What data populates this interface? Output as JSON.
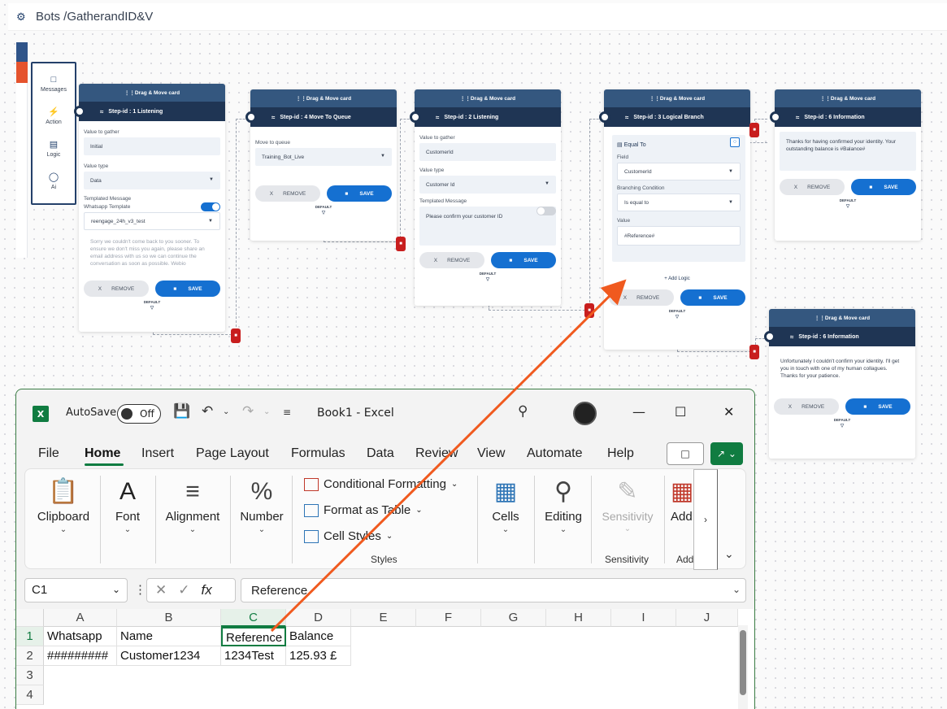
{
  "bot_builder": {
    "breadcrumb": "Bots /GatherandID&V",
    "palette": [
      "Messages",
      "Action",
      "Logic",
      "Ai"
    ],
    "drag_label": "Drag & Move card",
    "remove_label": "REMOVE",
    "save_label": "SAVE",
    "remove_x": "X",
    "default_label": "DEFAULT",
    "cards": {
      "listening1": {
        "title": "Step-id : 1 Listening",
        "value_label": "Value to gather",
        "value": "Initial",
        "type_label": "Value type",
        "type": "Data",
        "templated_label": "Templated Message",
        "whatsapp_label": "Whatsapp Template",
        "template": "reengage_24h_v3_test",
        "message": "Sorry we couldn't come back to you sooner. To ensure we don't miss you again, please share an email address with us so we can continue the conversation as soon as possible. Webio"
      },
      "queue": {
        "title": "Step-id : 4 Move To Queue",
        "queue_label": "Move to queue",
        "queue": "Training_Bot_Live"
      },
      "listening2": {
        "title": "Step-id : 2 Listening",
        "value_label": "Value to gather",
        "value": "CustomerId",
        "type_label": "Value type",
        "type": "Customer Id",
        "templated_label": "Templated Message",
        "message": "Please confirm your customer ID"
      },
      "logic": {
        "title": "Step-id : 3 Logical Branch",
        "equal_label": "Equal To",
        "field_label": "Field",
        "field": "CustomerId",
        "cond_label": "Branching Condition",
        "cond": "Is equal to",
        "value_label": "Value",
        "value": "#Reference#",
        "add_logic": "+ Add Logic"
      },
      "info1": {
        "title": "Step-id : 6 Information",
        "message": "Thanks for having confirmed your identity. Your outstanding balance is #Balance#"
      },
      "info2": {
        "title": "Step-id : 6 Information",
        "message": "Unfortunately I couldn't confirm your identity. I'll get you in touch with one of my human collagues. Thanks for your patience."
      }
    }
  },
  "excel": {
    "autosave_label": "AutoSave",
    "autosave_state": "Off",
    "book_title": "Book1  -  Excel",
    "menu": [
      "File",
      "Home",
      "Insert",
      "Page Layout",
      "Formulas",
      "Data",
      "Review",
      "View",
      "Automate",
      "Help"
    ],
    "ribbon": {
      "clipboard": "Clipboard",
      "font": "Font",
      "alignment": "Alignment",
      "number": "Number",
      "cond_format": "Conditional Formatting",
      "format_table": "Format as Table",
      "cell_styles": "Cell Styles",
      "styles": "Styles",
      "cells": "Cells",
      "editing": "Editing",
      "sensitivity": "Sensitivity",
      "sensitivity_group": "Sensitivity",
      "addins": "Add",
      "addins_group": "Add"
    },
    "namebox": "C1",
    "formula": "Reference",
    "columns": [
      "A",
      "B",
      "C",
      "D",
      "E",
      "F",
      "G",
      "H",
      "I",
      "J"
    ],
    "rows": [
      "1",
      "2",
      "3",
      "4"
    ],
    "cells": [
      [
        "Whatsapp",
        "Name",
        "Reference",
        "Balance"
      ],
      [
        "#########",
        "Customer1234",
        "1234Test",
        "125.93 £"
      ]
    ]
  }
}
